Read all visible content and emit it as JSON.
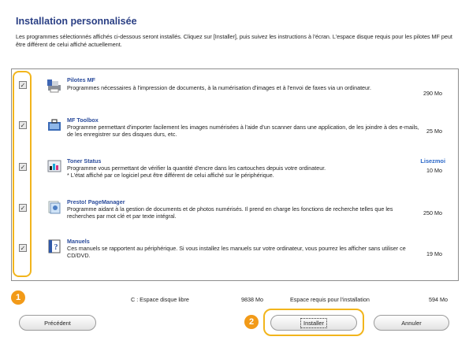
{
  "dialog": {
    "title": "Installation personnalisée",
    "intro": "Les programmes sélectionnés affichés ci-dessous seront installés. Cliquez sur [Installer], puis suivez les instructions à l'écran. L'espace disque requis pour les pilotes MF peut être différent de celui affiché actuellement."
  },
  "programs": [
    {
      "name": "Pilotes MF",
      "description": "Programmes nécessaires à l'impression de documents, à la numérisation d'images et à l'envoi de faxes via un ordinateur.",
      "size": "290 Mo",
      "checked": true,
      "icon": "printer-drivers-icon"
    },
    {
      "name": "MF Toolbox",
      "description": "Programme permettant d'importer facilement les images numérisées à l'aide d'un scanner dans une application, de les joindre à des e-mails, de les enregistrer sur des disques durs, etc.",
      "size": "25 Mo",
      "checked": true,
      "icon": "toolbox-icon"
    },
    {
      "name": "Toner Status",
      "description": "Programme vous permettant de vérifier la quantité d'encre dans les cartouches depuis votre ordinateur.\n* L'état affiché par ce logiciel peut être différent de celui affiché sur le périphérique.",
      "size": "10 Mo",
      "checked": true,
      "icon": "toner-status-icon",
      "readme": "Lisezmoi"
    },
    {
      "name": "Presto! PageManager",
      "description": "Programme aidant à la gestion de documents et de photos numérisés. Il prend en charge les fonctions de recherche telles que les recherches par mot clé et par texte intégral.",
      "size": "250 Mo",
      "checked": true,
      "icon": "pagemanager-icon"
    },
    {
      "name": "Manuels",
      "description": "Ces manuels se rapportent au périphérique. Si vous installez les manuels sur votre ordinateur, vous pourrez les afficher sans utiliser ce CD/DVD.",
      "size": "19 Mo",
      "checked": true,
      "icon": "manuals-icon"
    }
  ],
  "footer": {
    "free_space_label": "C : Espace disque libre",
    "free_space_value": "9838 Mo",
    "required_label": "Espace requis pour l'installation",
    "required_value": "594 Mo"
  },
  "buttons": {
    "back": "Précédent",
    "install": "Installer",
    "cancel": "Annuler"
  },
  "callouts": [
    "1",
    "2"
  ],
  "colors": {
    "title": "#2a3f84",
    "link": "#2b4c9c",
    "highlight": "#f2b51c",
    "badge": "#f29a18"
  }
}
